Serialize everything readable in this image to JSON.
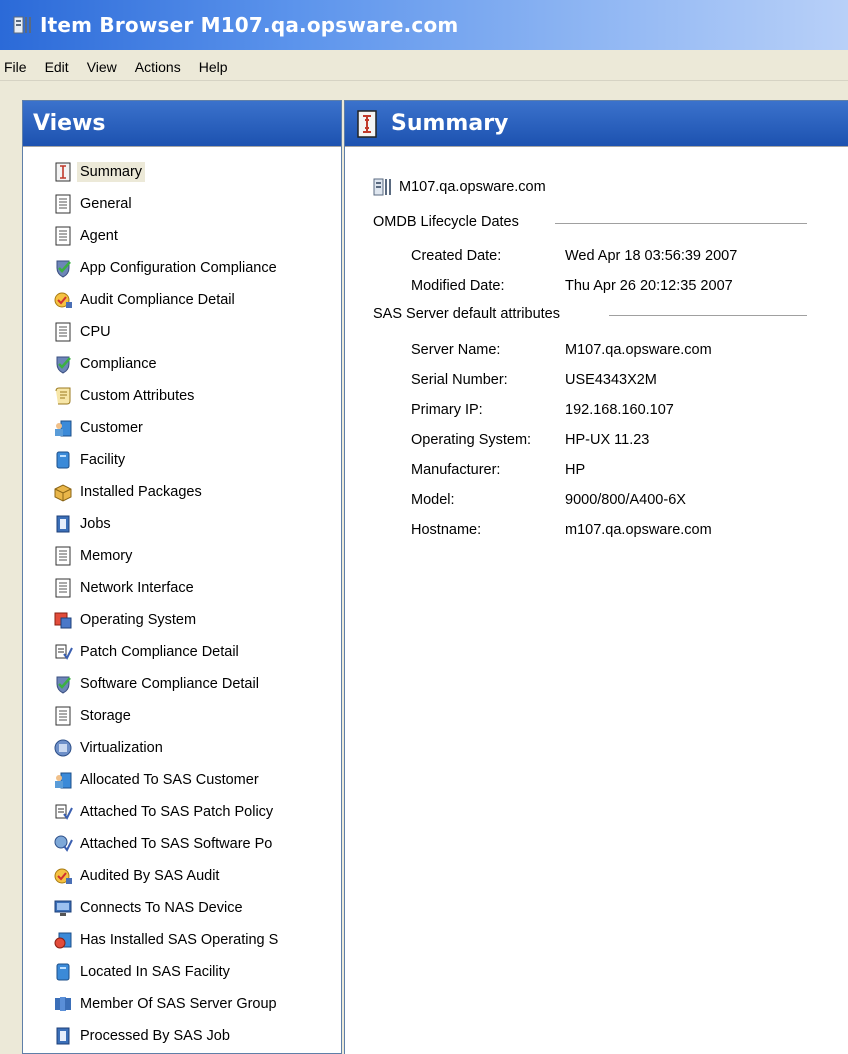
{
  "window": {
    "title": "Item Browser M107.qa.opsware.com"
  },
  "menu": [
    "File",
    "Edit",
    "View",
    "Actions",
    "Help"
  ],
  "views_panel": {
    "title": "Views",
    "items": [
      {
        "label": "Summary",
        "icon": "summary-icon",
        "selected": true
      },
      {
        "label": "General",
        "icon": "document-icon"
      },
      {
        "label": "Agent",
        "icon": "document-icon"
      },
      {
        "label": "App Configuration Compliance",
        "icon": "compliance-shield-icon"
      },
      {
        "label": "Audit Compliance Detail",
        "icon": "audit-icon"
      },
      {
        "label": "CPU",
        "icon": "document-icon"
      },
      {
        "label": "Compliance",
        "icon": "compliance-shield-icon"
      },
      {
        "label": "Custom Attributes",
        "icon": "scroll-icon"
      },
      {
        "label": "Customer",
        "icon": "customer-icon"
      },
      {
        "label": "Facility",
        "icon": "facility-icon"
      },
      {
        "label": "Installed Packages",
        "icon": "package-icon"
      },
      {
        "label": "Jobs",
        "icon": "job-icon"
      },
      {
        "label": "Memory",
        "icon": "document-icon"
      },
      {
        "label": "Network Interface",
        "icon": "document-icon"
      },
      {
        "label": "Operating System",
        "icon": "operating-system-icon"
      },
      {
        "label": "Patch Compliance Detail",
        "icon": "patch-policy-icon"
      },
      {
        "label": "Software Compliance Detail",
        "icon": "compliance-shield-icon"
      },
      {
        "label": "Storage",
        "icon": "document-icon"
      },
      {
        "label": "Virtualization",
        "icon": "virtualization-icon"
      },
      {
        "label": "Allocated To SAS Customer",
        "icon": "customer-icon"
      },
      {
        "label": "Attached To SAS Patch Policy",
        "icon": "patch-policy-icon"
      },
      {
        "label": "Attached To SAS Software Po",
        "icon": "software-policy-icon"
      },
      {
        "label": "Audited By SAS Audit",
        "icon": "audit-icon"
      },
      {
        "label": "Connects To NAS Device",
        "icon": "monitor-icon"
      },
      {
        "label": "Has Installed SAS Operating S",
        "icon": "os-install-icon"
      },
      {
        "label": "Located In SAS Facility",
        "icon": "facility-icon"
      },
      {
        "label": "Member Of SAS Server Group",
        "icon": "server-group-icon"
      },
      {
        "label": "Processed By SAS Job",
        "icon": "job-icon"
      }
    ]
  },
  "summary_panel": {
    "title": "Summary",
    "host": "M107.qa.opsware.com",
    "lifecycle_group": {
      "title": "OMDB Lifecycle Dates",
      "fields": [
        {
          "label": "Created Date:",
          "value": "Wed Apr 18 03:56:39 2007"
        },
        {
          "label": "Modified Date:",
          "value": "Thu Apr 26 20:12:35 2007"
        }
      ]
    },
    "attributes_group": {
      "title": "SAS Server default attributes",
      "fields": [
        {
          "label": "Server Name:",
          "value": "M107.qa.opsware.com"
        },
        {
          "label": "Serial Number:",
          "value": "USE4343X2M"
        },
        {
          "label": "Primary IP:",
          "value": "192.168.160.107"
        },
        {
          "label": "Operating System:",
          "value": "HP-UX 11.23"
        },
        {
          "label": "Manufacturer:",
          "value": "HP"
        },
        {
          "label": "Model:",
          "value": "9000/800/A400-6X"
        },
        {
          "label": "Hostname:",
          "value": "m107.qa.opsware.com"
        }
      ]
    }
  },
  "colors": {
    "header_blue": "#1d52b0",
    "selection_bg": "#ece9d8"
  }
}
